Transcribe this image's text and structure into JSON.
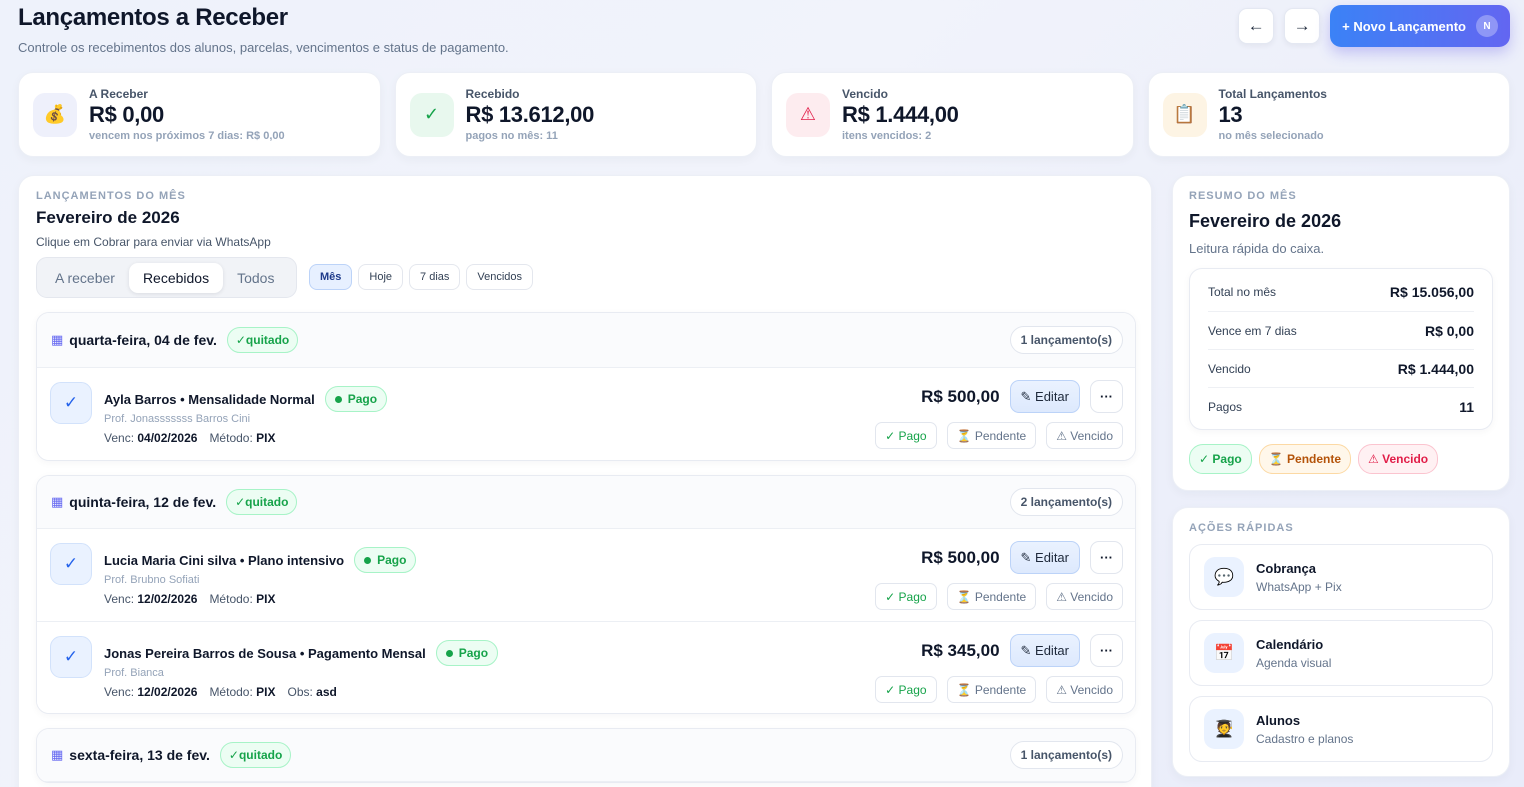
{
  "header": {
    "title": "Lançamentos a Receber",
    "subtitle": "Controle os recebimentos dos alunos, parcelas, vencimentos e status de pagamento.",
    "prev": "←",
    "next": "→",
    "new_label": "+ Novo Lançamento",
    "user_initial": "N"
  },
  "stats": [
    {
      "label": "A Receber",
      "value": "R$ 0,00",
      "note": "vencem nos próximos 7 dias: R$ 0,00",
      "icon": "money-bag-icon",
      "glyph": "💰",
      "color": "#eef0fb"
    },
    {
      "label": "Recebido",
      "value": "R$ 13.612,00",
      "note": "pagos no mês: 11",
      "icon": "check-icon",
      "glyph": "✓",
      "color": "#e8f8ee"
    },
    {
      "label": "Vencido",
      "value": "R$ 1.444,00",
      "note": "itens vencidos: 2",
      "icon": "warning-icon",
      "glyph": "⚠",
      "color": "#fdecef"
    },
    {
      "label": "Total Lançamentos",
      "value": "13",
      "note": "no mês selecionado",
      "icon": "clipboard-icon",
      "glyph": "📋",
      "color": "#fdf4e4"
    }
  ],
  "main": {
    "eyebrow": "LANÇAMENTOS DO MÊS",
    "title": "Fevereiro de 2026",
    "subtitle": "Clique em Cobrar para enviar via WhatsApp",
    "tabs": [
      "A receber",
      "Recebidos",
      "Todos"
    ],
    "active_tab": "Recebidos",
    "chips": [
      "Mês",
      "Hoje",
      "7 dias",
      "Vencidos"
    ],
    "active_chip": "Mês",
    "quitado": "✓quitado",
    "status_buttons": {
      "pago": "✓ Pago",
      "pendente": "⏳ Pendente",
      "vencido": "⚠ Vencido"
    },
    "edit_label": "✎ Editar",
    "more_label": "···",
    "venc_label": "Venc:",
    "metodo_label": "Método:",
    "obs_label": "Obs:",
    "pago_badge": "Pago",
    "groups": [
      {
        "date": "quarta-feira, 04 de fev.",
        "count": "1 lançamento(s)",
        "rows": [
          {
            "name": "Ayla Barros • Mensalidade Normal",
            "prof": "Prof. Jonasssssss Barros Cini",
            "venc": "04/02/2026",
            "metodo": "PIX",
            "obs": "",
            "amount": "R$ 500,00"
          }
        ]
      },
      {
        "date": "quinta-feira, 12 de fev.",
        "count": "2 lançamento(s)",
        "rows": [
          {
            "name": "Lucia Maria Cini silva • Plano intensivo",
            "prof": "Prof. Brubno Sofiati",
            "venc": "12/02/2026",
            "metodo": "PIX",
            "obs": "",
            "amount": "R$ 500,00"
          },
          {
            "name": "Jonas Pereira Barros de Sousa • Pagamento Mensal",
            "prof": "Prof. Bianca",
            "venc": "12/02/2026",
            "metodo": "PIX",
            "obs": "asd",
            "amount": "R$ 345,00"
          }
        ]
      },
      {
        "date": "sexta-feira, 13 de fev.",
        "count": "1 lançamento(s)",
        "rows": []
      }
    ]
  },
  "resumo": {
    "eyebrow": "RESUMO DO MÊS",
    "title": "Fevereiro de 2026",
    "subtitle": "Leitura rápida do caixa.",
    "rows": [
      {
        "label": "Total no mês",
        "value": "R$ 15.056,00"
      },
      {
        "label": "Vence em 7 dias",
        "value": "R$ 0,00"
      },
      {
        "label": "Vencido",
        "value": "R$ 1.444,00"
      },
      {
        "label": "Pagos",
        "value": "11"
      }
    ],
    "legend": {
      "pago": "✓ Pago",
      "pendente": "⏳ Pendente",
      "vencido": "⚠ Vencido"
    }
  },
  "acoes": {
    "eyebrow": "AÇÕES RÁPIDAS",
    "items": [
      {
        "title": "Cobrança",
        "sub": "WhatsApp + Pix",
        "icon": "chat-bubble-icon",
        "glyph": "💬"
      },
      {
        "title": "Calendário",
        "sub": "Agenda visual",
        "icon": "calendar-icon",
        "glyph": "📅"
      },
      {
        "title": "Alunos",
        "sub": "Cadastro e planos",
        "icon": "student-icon",
        "glyph": "🧑‍🎓"
      }
    ]
  }
}
